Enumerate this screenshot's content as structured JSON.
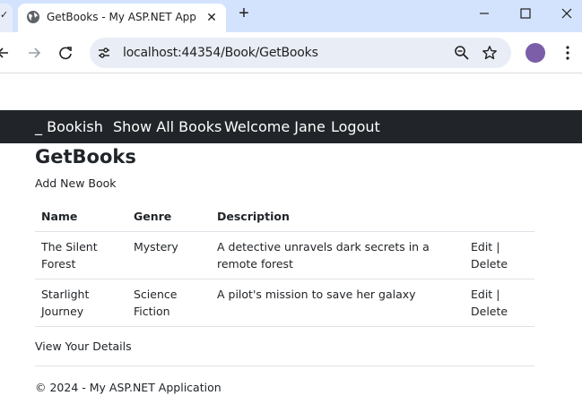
{
  "browser": {
    "tab_title": "GetBooks - My ASP.NET Application",
    "url": "localhost:44354/Book/GetBooks",
    "icons": [
      "globe-icon",
      "close-icon",
      "new-tab-icon",
      "minimize-icon",
      "maximize-icon",
      "window-close-icon",
      "back-icon",
      "forward-icon",
      "reload-icon",
      "site-info-icon",
      "zoom-icon",
      "star-icon",
      "kebab-menu-icon"
    ]
  },
  "nav": {
    "brand": "_ Bookish",
    "items": [
      {
        "label": "Show All Books"
      },
      {
        "label": "Welcome Jane"
      },
      {
        "label": "Logout"
      }
    ]
  },
  "page": {
    "title": "GetBooks",
    "add_new": "Add New Book",
    "view_details": "View Your Details"
  },
  "table": {
    "headers": [
      "Name",
      "Genre",
      "Description",
      ""
    ],
    "rows": [
      {
        "name": "The Silent Forest",
        "genre": "Mystery",
        "description": "A detective unravels dark secrets in a remote forest",
        "edit": "Edit",
        "sep": " |",
        "delete": "Delete"
      },
      {
        "name": "Starlight Journey",
        "genre": "Science Fiction",
        "description": "A pilot's mission to save her galaxy",
        "edit": "Edit",
        "sep": " |",
        "delete": "Delete"
      }
    ]
  },
  "footer": "© 2024 - My ASP.NET Application",
  "colors": {
    "navbar": "#212529",
    "tabstrip": "#d3e3fd",
    "omnibox": "#e9eef6",
    "text": "#212529"
  }
}
